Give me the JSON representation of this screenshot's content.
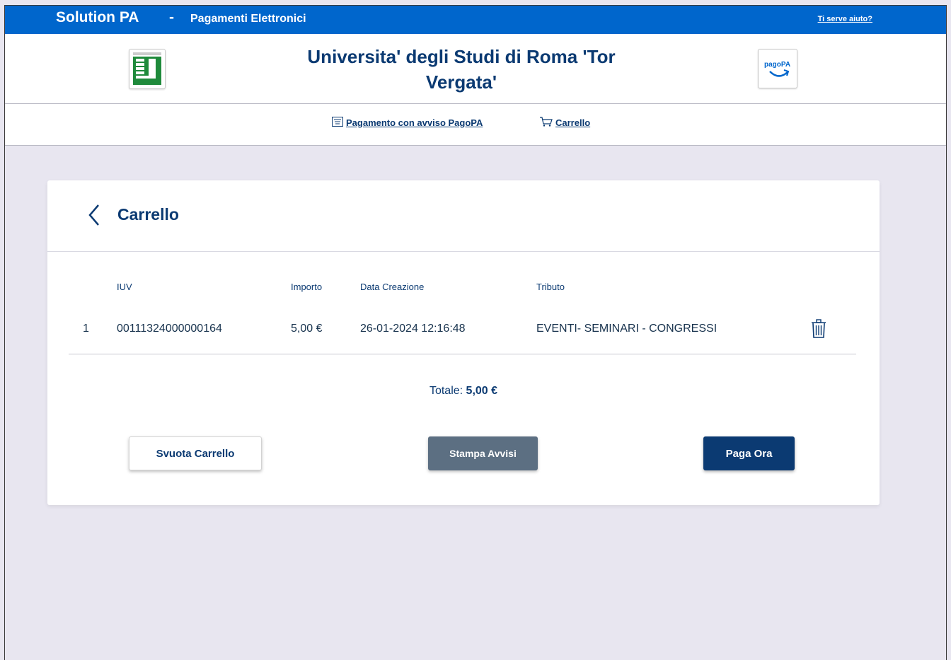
{
  "topbar": {
    "brand": "Solution PA",
    "separator": "-",
    "subtitle": "Pagamenti Elettronici",
    "help_link": "Ti serve aiuto?"
  },
  "header": {
    "title_line1": "Universita' degli Studi di Roma 'Tor",
    "title_line2": "Vergata'",
    "left_logo_icon": "university-logo",
    "right_logo_icon": "pagopa-logo",
    "right_logo_text": "pagoPA"
  },
  "nav": {
    "items": [
      {
        "label": "Pagamento con avviso PagoPA",
        "icon": "document-list-icon"
      },
      {
        "label": "Carrello",
        "icon": "cart-icon"
      }
    ]
  },
  "cart": {
    "title": "Carrello",
    "columns": [
      "IUV",
      "Importo",
      "Data Creazione",
      "Tributo"
    ],
    "rows": [
      {
        "index": "1",
        "iuv": "00111324000000164",
        "importo": "5,00 €",
        "data": "26-01-2024 12:16:48",
        "tributo": "EVENTI- SEMINARI - CONGRESSI"
      }
    ],
    "total_label": "Totale:",
    "total_value": "5,00 €"
  },
  "buttons": {
    "empty_cart": "Svuota Carrello",
    "print_notices": "Stampa Avvisi",
    "pay_now": "Paga Ora"
  },
  "colors": {
    "primary": "#0066cc",
    "navy": "#0b3a72",
    "gray_button": "#5c6f82",
    "background": "#e8e6f0"
  }
}
